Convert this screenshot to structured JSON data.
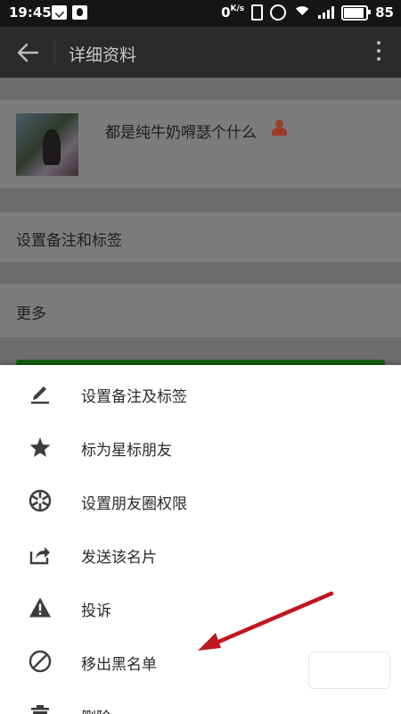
{
  "status_bar": {
    "time": "19:45",
    "net_speed": "0",
    "net_speed_unit": "K/s",
    "battery": "85"
  },
  "titlebar": {
    "title": "详细资料",
    "back_icon": "arrow-left-icon",
    "more_icon": "more-vertical-icon"
  },
  "profile": {
    "nickname": "都是纯牛奶嘚瑟个什么"
  },
  "rows": {
    "remark": "设置备注和标签",
    "more": "更多"
  },
  "action_sheet": {
    "items": [
      {
        "label": "设置备注及标签",
        "icon": "pencil-icon"
      },
      {
        "label": "标为星标朋友",
        "icon": "star-icon"
      },
      {
        "label": "设置朋友圈权限",
        "icon": "aperture-icon"
      },
      {
        "label": "发送该名片",
        "icon": "share-icon"
      },
      {
        "label": "投诉",
        "icon": "warning-icon"
      },
      {
        "label": "移出黑名单",
        "icon": "block-icon"
      },
      {
        "label": "删除",
        "icon": "trash-icon"
      }
    ]
  },
  "colors": {
    "sheet_bg": "#ffffff",
    "icon": "#3d3d3d",
    "arrow": "#c0171d",
    "send_button": "#135f13"
  }
}
